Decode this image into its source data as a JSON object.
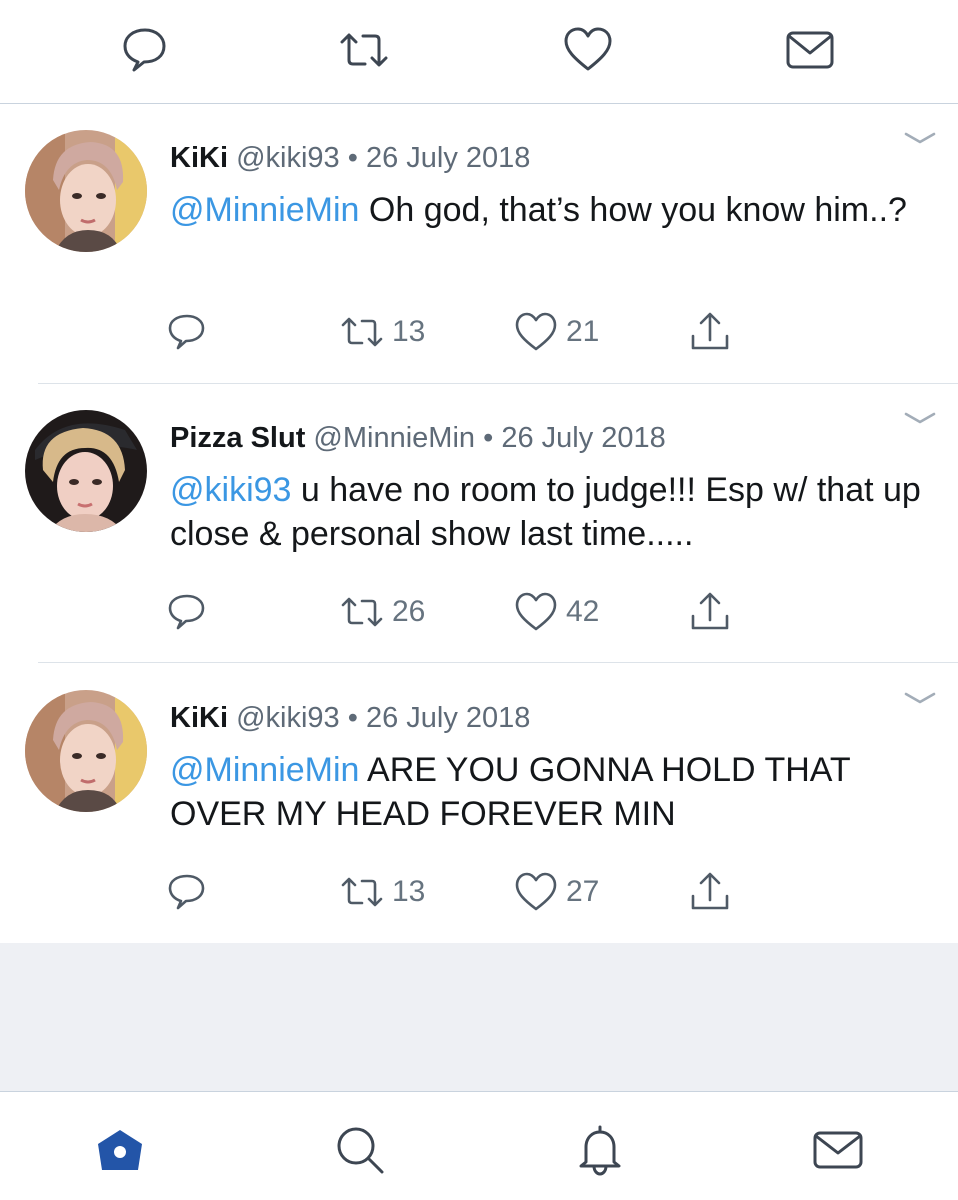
{
  "colors": {
    "mention": "#3b97e3",
    "text": "#14171a",
    "meta": "#5e6a77",
    "icon": "#3d4652",
    "active_tab": "#2355a8",
    "footer_bg": "#eef0f4"
  },
  "top_actions": [
    {
      "icon": "reply-icon"
    },
    {
      "icon": "retweet-icon"
    },
    {
      "icon": "like-icon"
    },
    {
      "icon": "message-icon"
    }
  ],
  "tweets": [
    {
      "name": "KiKi",
      "handle": "@kiki93",
      "dot": "•",
      "date": "26 July 2018",
      "mention": "@MinnieMin",
      "text": " Oh god, that’s how you know him..?",
      "retweets": "13",
      "likes": "21"
    },
    {
      "name": "Pizza Slut",
      "handle": "@MinnieMin",
      "dot": "•",
      "date": "26 July 2018",
      "mention": "@kiki93",
      "text": " u have no room to judge!!! Esp w/ that up close & personal show last time.....",
      "retweets": "26",
      "likes": "42"
    },
    {
      "name": "KiKi",
      "handle": "@kiki93",
      "dot": "•",
      "date": "26 July 2018",
      "mention": "@MinnieMin",
      "text": " ARE YOU GONNA HOLD THAT OVER MY HEAD FOREVER MIN",
      "retweets": "13",
      "likes": "27"
    }
  ],
  "tab_bar": [
    {
      "icon": "home-icon",
      "active": true
    },
    {
      "icon": "search-icon",
      "active": false
    },
    {
      "icon": "notifications-icon",
      "active": false
    },
    {
      "icon": "messages-icon",
      "active": false
    }
  ]
}
